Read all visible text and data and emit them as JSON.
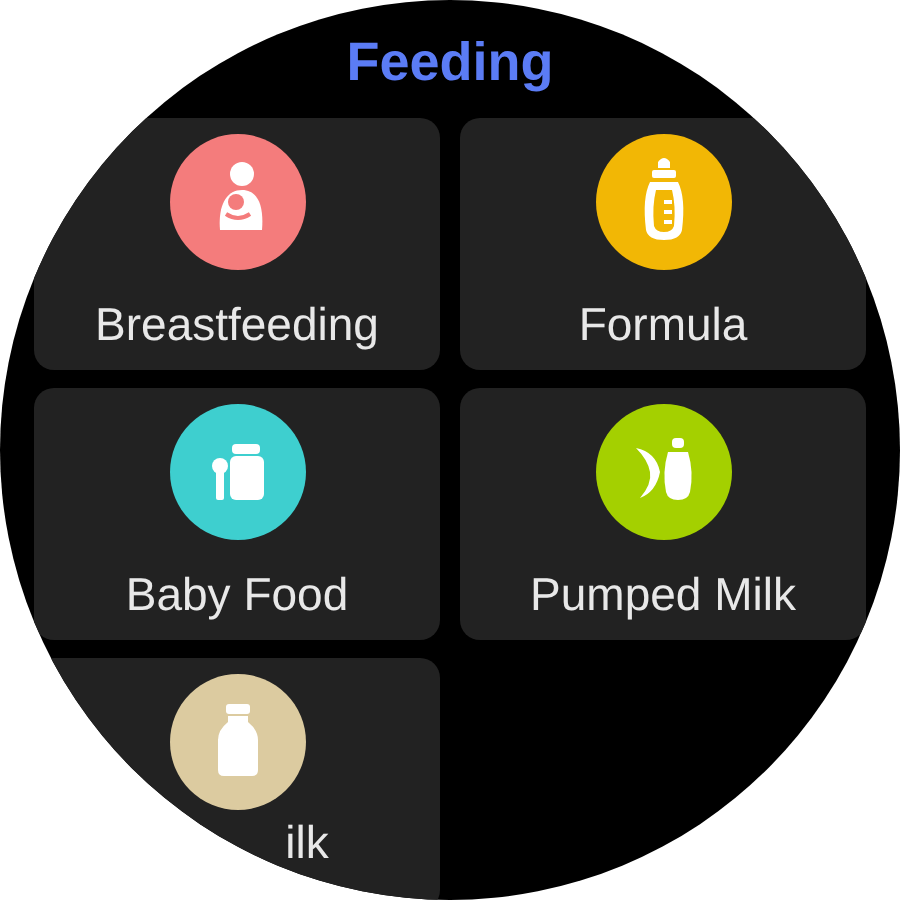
{
  "title": "Feeding",
  "items": [
    {
      "label": "Breastfeeding",
      "kind": "breastfeeding",
      "color": "#f47c7c"
    },
    {
      "label": "Formula",
      "kind": "formula",
      "color": "#f2b705"
    },
    {
      "label": "Baby Food",
      "kind": "babyfood",
      "color": "#3ecfcf"
    },
    {
      "label": "Pumped Milk",
      "kind": "pumped",
      "color": "#a4d000"
    },
    {
      "label": "ilk",
      "kind": "milk",
      "color": "#dccba0"
    }
  ]
}
